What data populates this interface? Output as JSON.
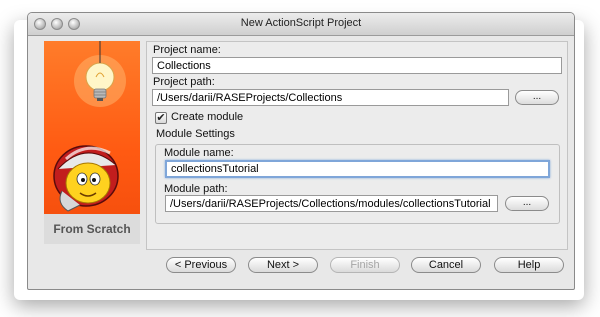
{
  "window": {
    "title": "New ActionScript Project"
  },
  "left_panel": {
    "caption": "From Scratch",
    "art": "lightbulb-and-helmet-mascot"
  },
  "form": {
    "project_name_label": "Project name:",
    "project_name_value": "Collections",
    "project_path_label": "Project path:",
    "project_path_value": "/Users/darii/RASEProjects/Collections",
    "browse_label": "...",
    "create_module_label": "Create module",
    "create_module_checked": true,
    "module_settings_label": "Module Settings",
    "module_name_label": "Module name:",
    "module_name_value": "collectionsTutorial",
    "module_path_label": "Module path:",
    "module_path_value": "/Users/darii/RASEProjects/Collections/modules/collectionsTutorial"
  },
  "buttons": {
    "previous": "< Previous",
    "next": "Next >",
    "finish": "Finish",
    "cancel": "Cancel",
    "help": "Help"
  },
  "checkmark_glyph": "✔"
}
